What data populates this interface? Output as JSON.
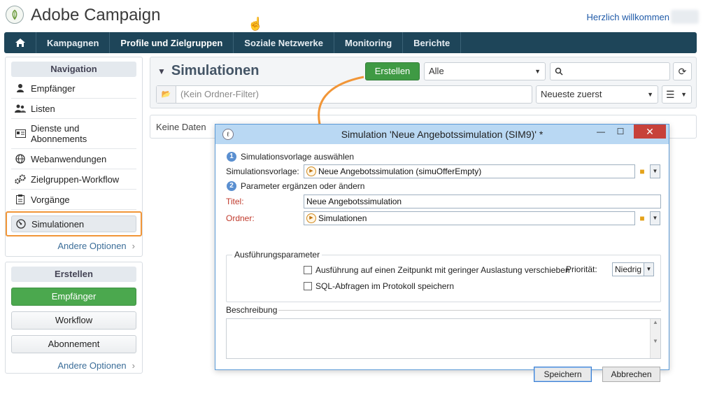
{
  "header": {
    "brand": "Adobe Campaign",
    "welcome": "Herzlich willkommen"
  },
  "topnav": {
    "items": [
      "Kampagnen",
      "Profile und Zielgruppen",
      "Soziale Netzwerke",
      "Monitoring",
      "Berichte"
    ],
    "active": "Profile und Zielgruppen"
  },
  "navigation": {
    "title": "Navigation",
    "items": [
      "Empfänger",
      "Listen",
      "Dienste und Abonnements",
      "Webanwendungen",
      "Zielgruppen-Workflow",
      "Vorgänge",
      "Simulationen"
    ],
    "more": "Andere Optionen"
  },
  "create": {
    "title": "Erstellen",
    "buttons": [
      "Empfänger",
      "Workflow",
      "Abonnement"
    ],
    "more": "Andere Optionen"
  },
  "main": {
    "title": "Simulationen",
    "create_button": "Erstellen",
    "filter_value": "Alle",
    "folder_filter": "(Kein Ordner-Filter)",
    "sort_value": "Neueste zuerst",
    "empty_text": "Keine Daten"
  },
  "dialog": {
    "title": "Simulation 'Neue Angebotssimulation (SIM9)' *",
    "step1": "Simulationsvorlage auswählen",
    "template_label": "Simulationsvorlage:",
    "template_value": "Neue Angebotssimulation (simuOfferEmpty)",
    "step2": "Parameter ergänzen oder ändern",
    "title_label": "Titel:",
    "title_value": "Neue Angebotssimulation",
    "folder_label": "Ordner:",
    "folder_value": "Simulationen",
    "exec_group": "Ausführungsparameter",
    "check_lowload": "Ausführung auf einen Zeitpunkt mit geringer Auslastung verschieben",
    "priority_label": "Priorität:",
    "priority_value": "Niedrig",
    "check_sql": "SQL-Abfragen im Protokoll speichern",
    "description_label": "Beschreibung",
    "save_button": "Speichern",
    "cancel_button": "Abbrechen"
  },
  "colors": {
    "nav_bar": "#1e4559",
    "accent_orange": "#f19638",
    "green": "#4ba84e",
    "dialog_title_bg": "#b9d8f3",
    "close_red": "#c7413a"
  }
}
